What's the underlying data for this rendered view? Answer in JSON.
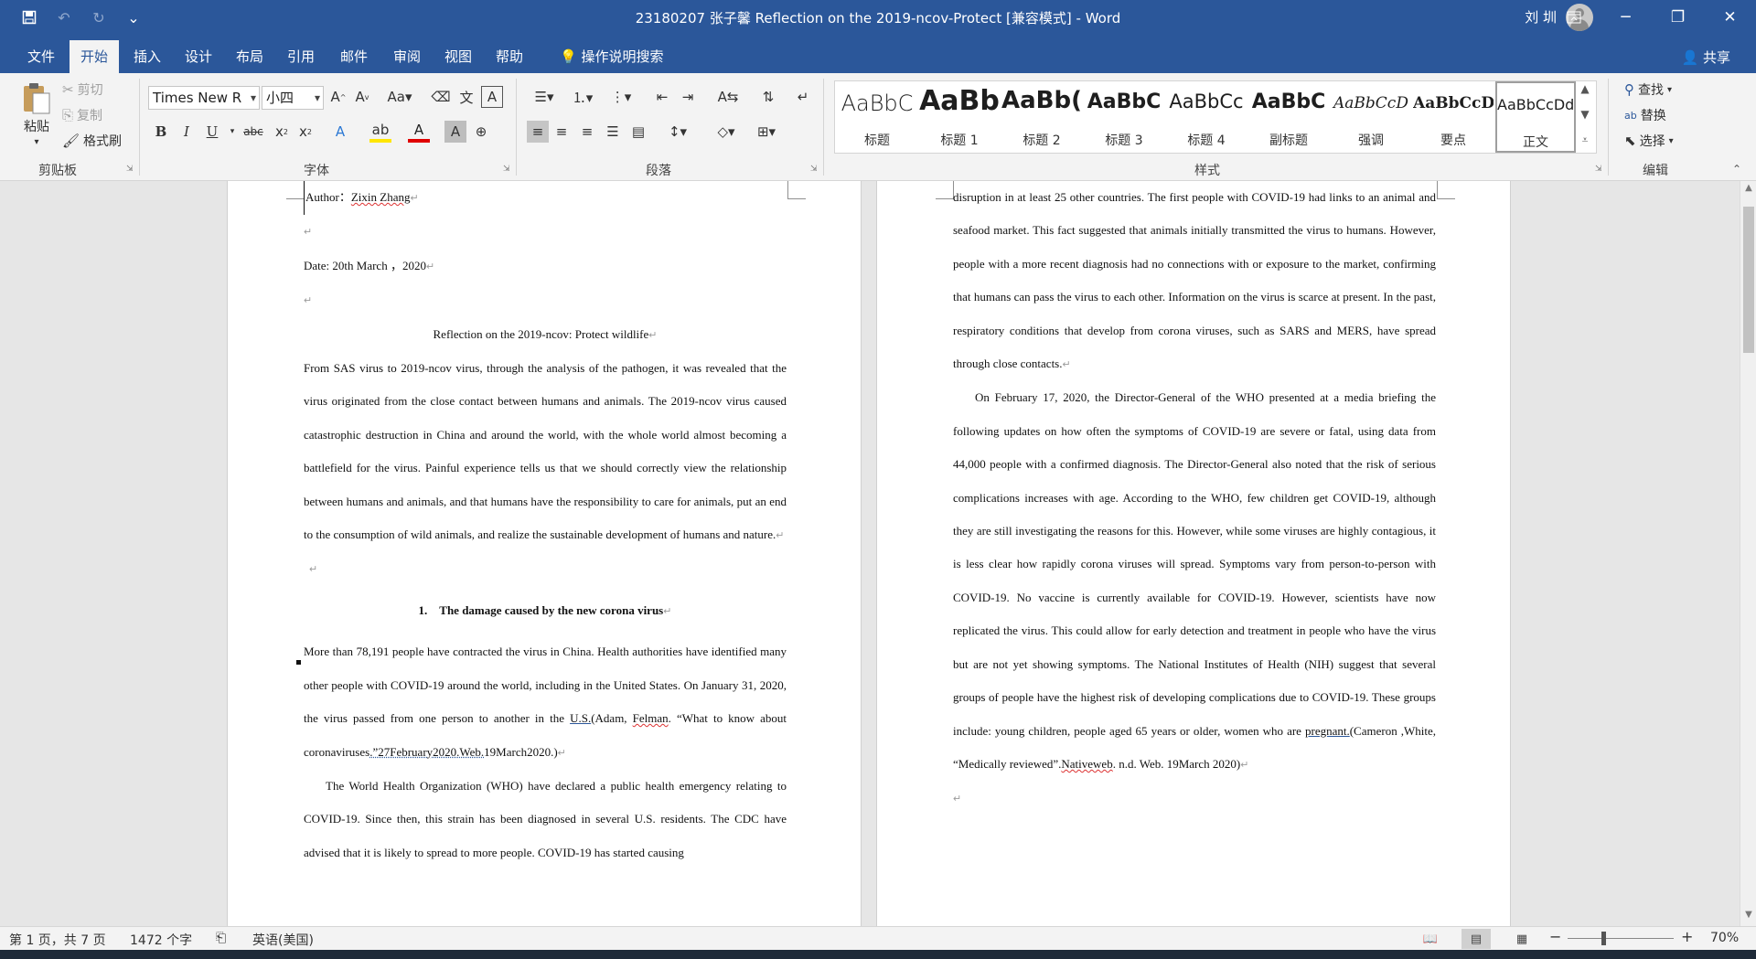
{
  "titlebar": {
    "title": "23180207 张子馨 Reflection on the 2019-ncov-Protect [兼容模式]  -  Word",
    "user": "刘 圳",
    "save_icon": "save-icon",
    "undo_icon": "undo-icon",
    "redo_icon": "redo-icon",
    "customize_icon": "customize-qat-icon"
  },
  "tabs": {
    "file": "文件",
    "home": "开始",
    "insert": "插入",
    "design": "设计",
    "layout": "布局",
    "references": "引用",
    "mailings": "邮件",
    "review": "审阅",
    "view": "视图",
    "help": "帮助",
    "tellme": "操作说明搜索",
    "share": "共享"
  },
  "clipboard": {
    "paste": "粘贴",
    "cut": "剪切",
    "copy": "复制",
    "format_painter": "格式刷",
    "label": "剪贴板"
  },
  "font": {
    "name": "Times New R",
    "size": "小四",
    "label": "字体"
  },
  "paragraph": {
    "label": "段落"
  },
  "styles": {
    "label": "样式",
    "items": [
      {
        "preview": "AaBbC",
        "name": "标题"
      },
      {
        "preview": "AaBb",
        "name": "标题 1"
      },
      {
        "preview": "AaBb(",
        "name": "标题 2"
      },
      {
        "preview": "AaBbC",
        "name": "标题 3"
      },
      {
        "preview": "AaBbCc",
        "name": "标题 4"
      },
      {
        "preview": "AaBbC",
        "name": "副标题"
      },
      {
        "preview": "AaBbCcD",
        "name": "强调"
      },
      {
        "preview": "AaBbCcD",
        "name": "要点"
      },
      {
        "preview": "AaBbCcDd",
        "name": "正文"
      }
    ]
  },
  "editing": {
    "find": "查找",
    "replace": "替换",
    "select": "选择",
    "label": "编辑"
  },
  "page1": {
    "author_label": "Author：",
    "author_name": "Zixin Zhang",
    "date": "Date: 20th March ，2020",
    "title": "Reflection on the 2019-ncov: Protect wildlife",
    "intro": "From SAS virus to 2019-ncov virus, through the analysis of the pathogen, it was revealed that the virus originated from the close contact between humans and animals. The 2019-ncov virus caused catastrophic destruction in China and around the world, with the whole world almost becoming a battlefield for the virus. Painful experience tells us that we should correctly view the relationship between humans and animals, and that humans have the responsibility to care for animals, put an end to the consumption of wild animals, and realize the sustainable development of humans and nature.",
    "heading_num": "1.",
    "heading": "The damage caused by the new corona virus",
    "p1_a": "More than 78,191 people have contracted the virus in China. Health authorities have identified many other people with COVID-19 around the world, including in the United States. On January 31, 2020, the virus passed from one person to another in the ",
    "p1_link": "U.S.",
    "p1_b": "(Adam, ",
    "p1_felman": "Felman",
    "p1_c": ". “What to know about coronaviruses",
    "p1_d": ".”27February2020.Web.",
    "p1_e": "19March2020.)",
    "p2": "The World Health Organization (WHO) have declared a public health emergency relating to COVID-19. Since then, this strain has been diagnosed in several U.S. residents. The CDC have advised that it is likely to spread to more people. COVID-19 has started causing"
  },
  "page2": {
    "p1": "disruption in at least 25 other countries. The first people with COVID-19 had links to an animal and seafood market. This fact suggested that animals initially transmitted the virus to humans. However, people with a more recent diagnosis had no connections with or exposure to the market, confirming that humans can pass the virus to each other. Information on the virus is scarce at present. In the past, respiratory conditions that develop from corona viruses, such as SARS and MERS, have spread through close contacts.",
    "p2_a": "On February 17, 2020, the Director-General of the WHO presented at a media briefing the following updates on how often the symptoms of COVID-19 are severe or fatal, using data from 44,000 people with a confirmed diagnosis. The Director-General also noted that the risk of serious complications increases with age. According to the WHO, few children get COVID-19, although they are still investigating the reasons for this. However, while some viruses are highly contagious, it is less clear how rapidly corona viruses will spread. Symptoms vary from person-to-person with COVID-19. No vaccine is currently available for COVID-19. However, scientists have now replicated the virus. This could allow for early detection and treatment in people who have the virus but are not yet showing symptoms. The National Institutes of Health (NIH) suggest that several groups of people have the highest risk of developing complications due to COVID-19. These groups include: young children, people aged 65 years or older, women who are ",
    "p2_link": "pregnant.",
    "p2_b": "(Cameron ,White, “Medically reviewed”.",
    "p2_native": "Nativeweb",
    "p2_c": ". n.d. Web. 19March 2020)"
  },
  "status": {
    "page": "第 1 页，共 7 页",
    "words": "1472 个字",
    "language": "英语(美国)",
    "zoom": "70%",
    "zoom_level_percent": 70
  },
  "marks": {
    "para": "↵"
  }
}
